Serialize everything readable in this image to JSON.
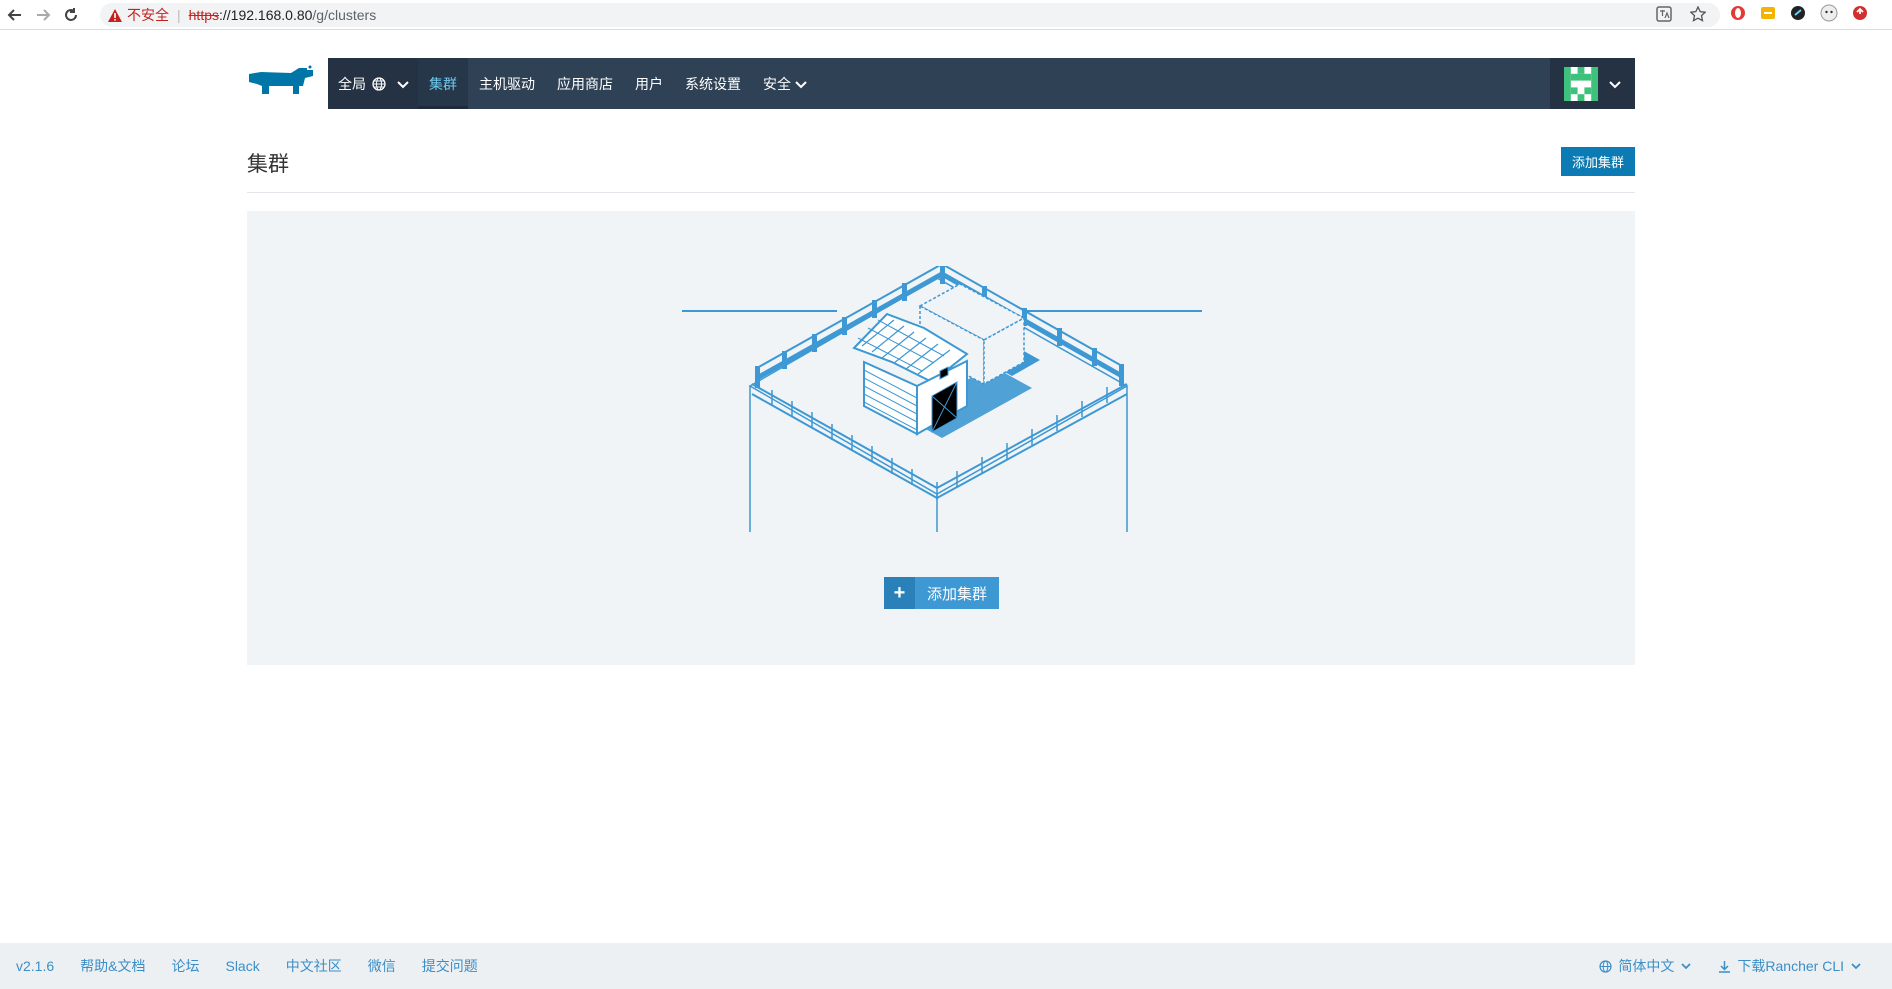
{
  "browser": {
    "security_label": "不安全",
    "url_protocol": "https",
    "url_host": "://192.168.0.80",
    "url_path": "/g/clusters"
  },
  "topnav": {
    "scope_label": "全局",
    "items": [
      {
        "label": "集群",
        "active": true
      },
      {
        "label": "主机驱动"
      },
      {
        "label": "应用商店"
      },
      {
        "label": "用户"
      },
      {
        "label": "系统设置"
      },
      {
        "label": "安全"
      }
    ]
  },
  "page": {
    "title": "集群",
    "add_button": "添加集群"
  },
  "empty_state": {
    "add_button": "添加集群"
  },
  "footer": {
    "version": "v2.1.6",
    "links": [
      "帮助&文档",
      "论坛",
      "Slack",
      "中文社区",
      "微信",
      "提交问题"
    ],
    "language": "简体中文",
    "download": "下载Rancher CLI"
  },
  "colors": {
    "nav_bg": "#2f4155",
    "accent": "#0c7bb3",
    "illustration": "#3d98d3"
  }
}
